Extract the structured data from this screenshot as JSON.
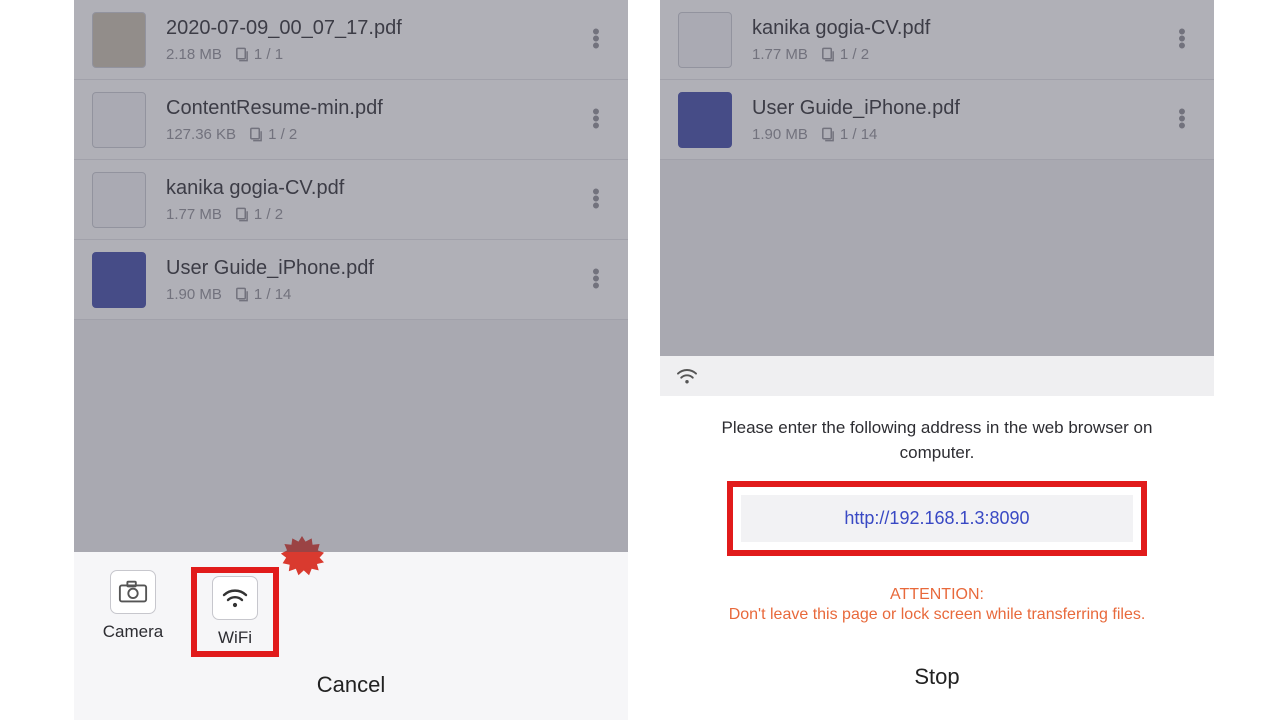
{
  "left": {
    "files": [
      {
        "name": "2020-07-09_00_07_17.pdf",
        "size": "2.18 MB",
        "pages": "1 / 1",
        "thumb": "photo"
      },
      {
        "name": "ContentResume-min.pdf",
        "size": "127.36 KB",
        "pages": "1 / 2",
        "thumb": "doc"
      },
      {
        "name": "kanika gogia-CV.pdf",
        "size": "1.77 MB",
        "pages": "1 / 2",
        "thumb": "doc"
      },
      {
        "name": "User Guide_iPhone.pdf",
        "size": "1.90 MB",
        "pages": "1 / 14",
        "thumb": "blue"
      }
    ],
    "options": {
      "camera": "Camera",
      "wifi": "WiFi"
    },
    "cancel": "Cancel"
  },
  "right": {
    "files": [
      {
        "name": "kanika gogia-CV.pdf",
        "size": "1.77 MB",
        "pages": "1 / 2",
        "thumb": "doc"
      },
      {
        "name": "User Guide_iPhone.pdf",
        "size": "1.90 MB",
        "pages": "1 / 14",
        "thumb": "blue"
      }
    ],
    "panel": {
      "instruction": "Please enter the following address in the web browser on computer.",
      "url": "http://192.168.1.3:8090",
      "attention_head": "ATTENTION:",
      "attention_body": "Don't leave this page or lock screen while transferring files.",
      "stop": "Stop"
    }
  },
  "colors": {
    "highlight": "#e11b1b",
    "link": "#3949c4",
    "warn": "#e8693b"
  }
}
